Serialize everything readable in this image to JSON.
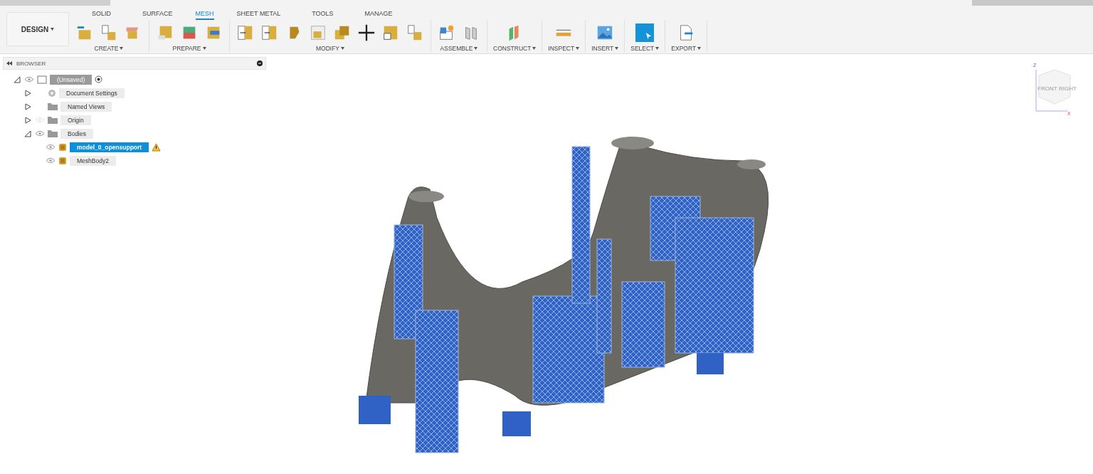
{
  "workspace": {
    "label": "DESIGN"
  },
  "tabs": [
    {
      "label": "SOLID",
      "selected": false
    },
    {
      "label": "SURFACE",
      "selected": false
    },
    {
      "label": "MESH",
      "selected": true
    },
    {
      "label": "SHEET METAL",
      "selected": false
    },
    {
      "label": "TOOLS",
      "selected": false
    },
    {
      "label": "MANAGE",
      "selected": false
    }
  ],
  "tool_groups": [
    {
      "label": "CREATE",
      "tools": [
        {
          "kind": "insert"
        },
        {
          "kind": "convert"
        },
        {
          "kind": "tessellate"
        }
      ]
    },
    {
      "label": "PREPARE",
      "tools": [
        {
          "kind": "repair"
        },
        {
          "kind": "faces"
        },
        {
          "kind": "groups"
        }
      ]
    },
    {
      "label": "MODIFY",
      "tools": [
        {
          "kind": "split"
        },
        {
          "kind": "split"
        },
        {
          "kind": "remesh"
        },
        {
          "kind": "shell"
        },
        {
          "kind": "combine"
        },
        {
          "kind": "move"
        },
        {
          "kind": "face"
        },
        {
          "kind": "convert"
        }
      ]
    },
    {
      "label": "ASSEMBLE",
      "tools": [
        {
          "kind": "component"
        },
        {
          "kind": "joint"
        }
      ]
    },
    {
      "label": "CONSTRUCT",
      "tools": [
        {
          "kind": "plane"
        }
      ]
    },
    {
      "label": "INSPECT",
      "tools": [
        {
          "kind": "measure"
        }
      ]
    },
    {
      "label": "INSERT",
      "tools": [
        {
          "kind": "image"
        }
      ]
    },
    {
      "label": "SELECT",
      "tools": [
        {
          "kind": "select"
        }
      ]
    },
    {
      "label": "EXPORT",
      "tools": [
        {
          "kind": "export"
        }
      ]
    }
  ],
  "browser": {
    "title": "BROWSER",
    "tree": [
      {
        "label": "(Unsaved)",
        "kind": "root",
        "visible": true,
        "expanded": true,
        "selected": false,
        "children": [
          {
            "label": "Document Settings",
            "kind": "settings",
            "expanded": false,
            "selected": false
          },
          {
            "label": "Named Views",
            "kind": "folder",
            "expanded": false,
            "selected": false
          },
          {
            "label": "Origin",
            "kind": "folder",
            "visible": false,
            "expanded": false,
            "selected": false
          },
          {
            "label": "Bodies",
            "kind": "folder",
            "visible": true,
            "expanded": true,
            "selected": false,
            "children": [
              {
                "label": "model_0_opensupport",
                "kind": "body",
                "visible": true,
                "selected": true,
                "warning": true
              },
              {
                "label": "MeshBody2",
                "kind": "body",
                "visible": true,
                "selected": false,
                "warning": false
              }
            ]
          }
        ]
      }
    ]
  },
  "view_cube": {
    "faces": [
      "FRONT",
      "RIGHT"
    ],
    "axes": [
      "Z",
      "X"
    ]
  }
}
